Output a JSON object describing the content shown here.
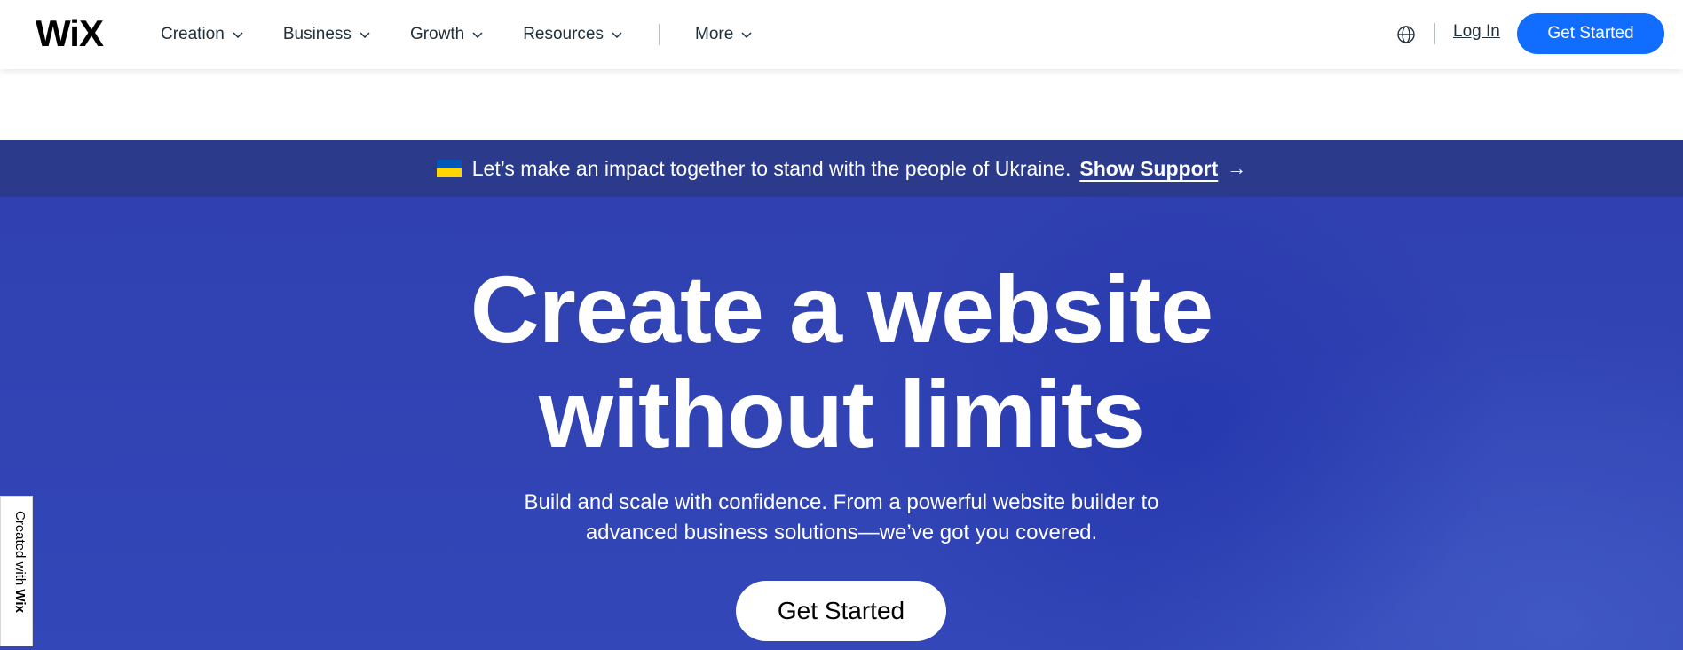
{
  "header": {
    "logo_text": "WiX",
    "nav": [
      {
        "label": "Creation"
      },
      {
        "label": "Business"
      },
      {
        "label": "Growth"
      },
      {
        "label": "Resources"
      },
      {
        "label": "More"
      }
    ],
    "login_label": "Log In",
    "cta_label": "Get Started",
    "globe_icon": "globe-icon"
  },
  "banner": {
    "flag_icon": "ukraine-flag-icon",
    "text": "Let’s make an impact together to stand with the people of Ukraine.",
    "link_label": "Show Support",
    "arrow": "→"
  },
  "hero": {
    "title_line1": "Create a website",
    "title_line2": "without limits",
    "subtitle_line1": "Build and scale with confidence. From a powerful website builder to",
    "subtitle_line2": "advanced business solutions—we’ve got you covered.",
    "cta_label": "Get Started"
  },
  "badge": {
    "prefix": "Created with ",
    "brand": "Wix"
  },
  "colors": {
    "primary_button": "#116dff",
    "banner_bg": "#2b3a8a",
    "hero_bg": "#3347b8"
  }
}
